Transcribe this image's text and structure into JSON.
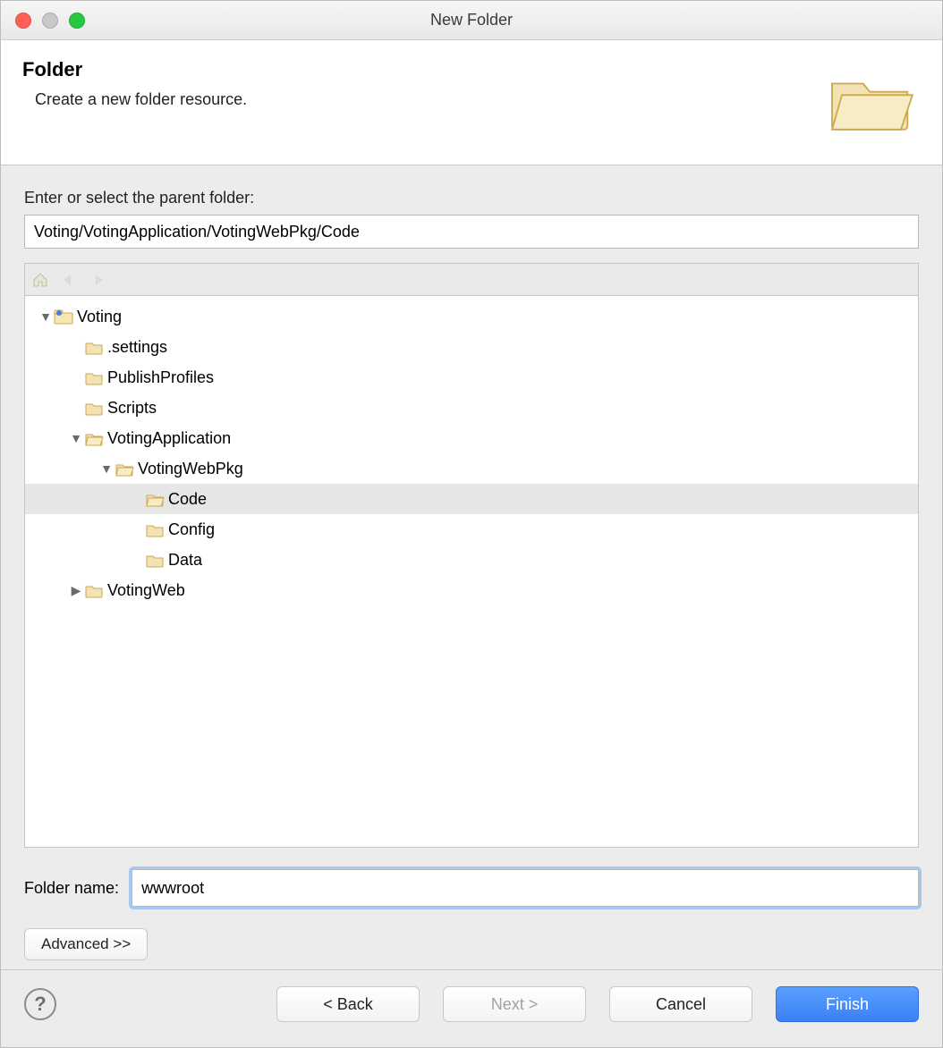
{
  "window": {
    "title": "New Folder"
  },
  "header": {
    "title": "Folder",
    "subtitle": "Create a new folder resource."
  },
  "parent": {
    "label": "Enter or select the parent folder:",
    "value": "Voting/VotingApplication/VotingWebPkg/Code"
  },
  "tree": {
    "nodes": [
      {
        "label": "Voting",
        "indent": 0,
        "expanded": true,
        "hasChildren": true,
        "icon": "project",
        "selected": false
      },
      {
        "label": ".settings",
        "indent": 1,
        "expanded": false,
        "hasChildren": false,
        "icon": "folder",
        "selected": false
      },
      {
        "label": "PublishProfiles",
        "indent": 1,
        "expanded": false,
        "hasChildren": false,
        "icon": "folder",
        "selected": false
      },
      {
        "label": "Scripts",
        "indent": 1,
        "expanded": false,
        "hasChildren": false,
        "icon": "folder",
        "selected": false
      },
      {
        "label": "VotingApplication",
        "indent": 1,
        "expanded": true,
        "hasChildren": true,
        "icon": "folder-open",
        "selected": false
      },
      {
        "label": "VotingWebPkg",
        "indent": 2,
        "expanded": true,
        "hasChildren": true,
        "icon": "folder-open",
        "selected": false
      },
      {
        "label": "Code",
        "indent": 3,
        "expanded": false,
        "hasChildren": false,
        "icon": "folder-open",
        "selected": true
      },
      {
        "label": "Config",
        "indent": 3,
        "expanded": false,
        "hasChildren": false,
        "icon": "folder",
        "selected": false
      },
      {
        "label": "Data",
        "indent": 3,
        "expanded": false,
        "hasChildren": false,
        "icon": "folder",
        "selected": false
      },
      {
        "label": "VotingWeb",
        "indent": 1,
        "expanded": false,
        "hasChildren": true,
        "icon": "folder",
        "selected": false
      }
    ]
  },
  "folderName": {
    "label": "Folder name:",
    "value": "wwwroot"
  },
  "buttons": {
    "advanced": "Advanced >>",
    "back": "< Back",
    "next": "Next >",
    "cancel": "Cancel",
    "finish": "Finish"
  }
}
